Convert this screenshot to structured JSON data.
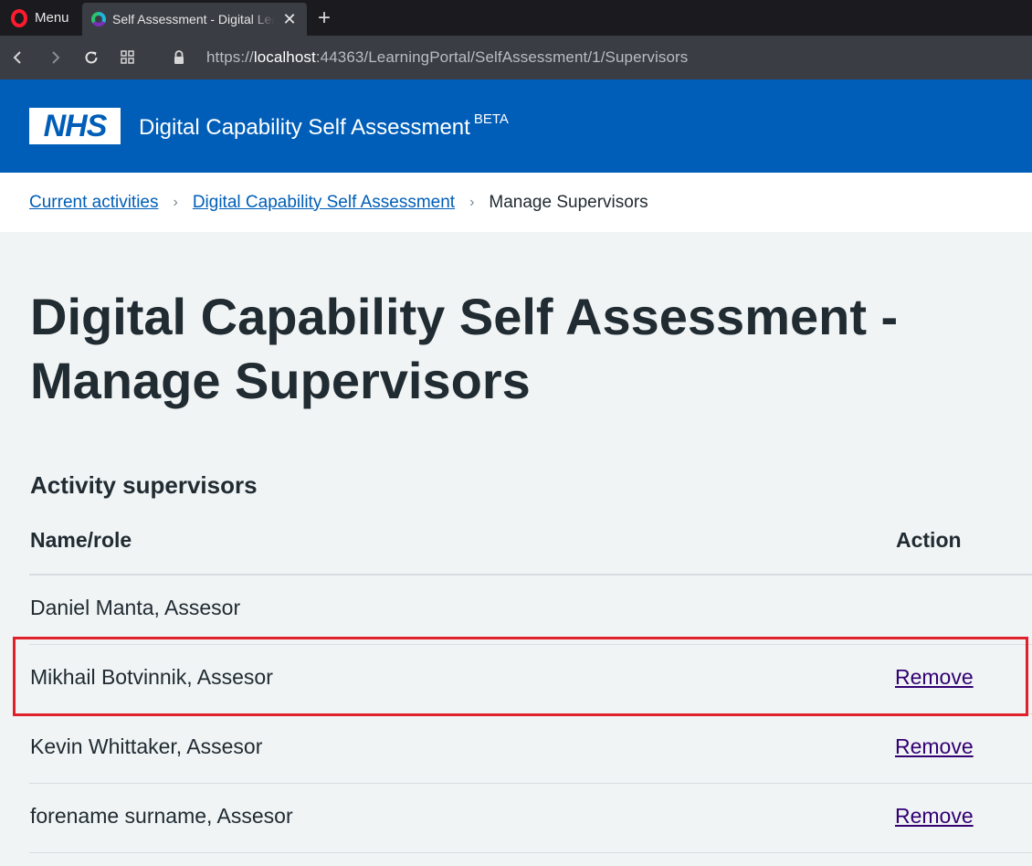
{
  "browser": {
    "menu_label": "Menu",
    "tab_title": "Self Assessment - Digital Learning Solutions",
    "url_prefix": "https://",
    "url_host": "localhost",
    "url_rest": ":44363/LearningPortal/SelfAssessment/1/Supervisors"
  },
  "header": {
    "logo_text": "NHS",
    "service_name": "Digital Capability Self Assessment",
    "beta_tag": "BETA"
  },
  "breadcrumb": {
    "items": [
      {
        "label": "Current activities"
      },
      {
        "label": "Digital Capability Self Assessment"
      }
    ],
    "current": "Manage Supervisors"
  },
  "main": {
    "title": "Digital Capability Self Assessment - Manage Supervisors",
    "section_heading": "Activity supervisors",
    "table": {
      "headers": {
        "name": "Name/role",
        "action": "Action"
      },
      "rows": [
        {
          "name": "Daniel Manta, Assesor",
          "action": ""
        },
        {
          "name": "Mikhail Botvinnik, Assesor",
          "action": "Remove"
        },
        {
          "name": "Kevin Whittaker, Assesor",
          "action": "Remove"
        },
        {
          "name": "forename surname, Assesor",
          "action": "Remove"
        }
      ]
    }
  },
  "colors": {
    "nhs_blue": "#005eb8",
    "text": "#212b32",
    "visited_link": "#330072",
    "highlight": "#e0202a"
  }
}
